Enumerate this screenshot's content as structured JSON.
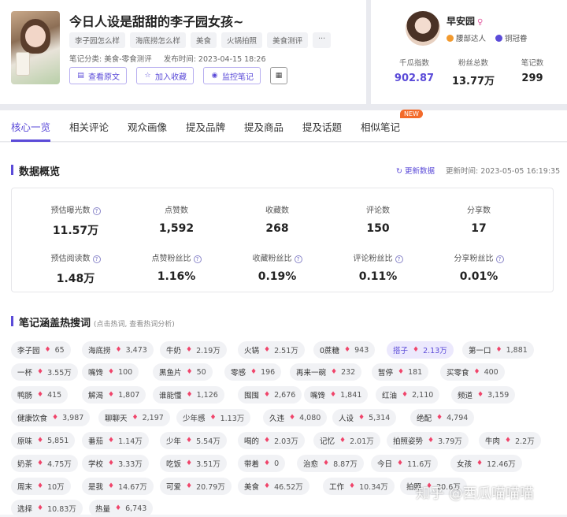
{
  "note": {
    "title": "今日人设是甜甜的李子园女孩~",
    "tags": [
      "李子园怎么样",
      "海底捞怎么样",
      "美食",
      "火锅拍照",
      "美食测评",
      "···"
    ],
    "category": "笔记分类: 美食-零食测评",
    "publish_time": "发布时间: 2023-04-15 18:26",
    "buttons": {
      "view_original": "查看原文",
      "add_favorite": "加入收藏",
      "monitor": "监控笔记"
    }
  },
  "user": {
    "name": "早安园",
    "gender_symbol": "♀",
    "label_1": "腰部达人",
    "label_2": "铜冠眷",
    "stats": [
      {
        "label": "千瓜指数",
        "value": "902.87"
      },
      {
        "label": "粉丝总数",
        "value": "13.77万"
      },
      {
        "label": "笔记数",
        "value": "299"
      }
    ]
  },
  "tabs": [
    "核心一览",
    "相关评论",
    "观众画像",
    "提及品牌",
    "提及商品",
    "提及话题",
    "相似笔记"
  ],
  "new_badge": "NEW",
  "overview": {
    "title": "数据概览",
    "refresh": "更新数据",
    "update_time": "更新时间: 2023-05-05 16:19:35",
    "row1": [
      {
        "label": "预估曝光数",
        "value": "11.57万",
        "q": true
      },
      {
        "label": "点赞数",
        "value": "1,592",
        "q": false
      },
      {
        "label": "收藏数",
        "value": "268",
        "q": false
      },
      {
        "label": "评论数",
        "value": "150",
        "q": false
      },
      {
        "label": "分享数",
        "value": "17",
        "q": false
      }
    ],
    "row2": [
      {
        "label": "预估阅读数",
        "value": "1.48万",
        "q": true
      },
      {
        "label": "点赞粉丝比",
        "value": "1.16%",
        "q": true
      },
      {
        "label": "收藏粉丝比",
        "value": "0.19%",
        "q": true
      },
      {
        "label": "评论粉丝比",
        "value": "0.11%",
        "q": true
      },
      {
        "label": "分享粉丝比",
        "value": "0.01%",
        "q": true
      }
    ]
  },
  "keywords": {
    "title": "笔记涵盖热搜词",
    "subtitle": "(点击热词, 查看热词分析)",
    "rows": [
      [
        [
          "李子园",
          "65"
        ],
        [
          "海底捞",
          "3,473"
        ],
        [
          "牛奶",
          "2.19万"
        ],
        [
          "火锅",
          "2.51万"
        ],
        [
          "0蔗糖",
          "943"
        ],
        [
          "搭子",
          "2.13万"
        ],
        [
          "第一口",
          "1,881"
        ]
      ],
      [
        [
          "一杯",
          "3.55万"
        ],
        [
          "嘴馋",
          "100"
        ],
        [
          "黑鱼片",
          "50"
        ],
        [
          "零感",
          "196"
        ],
        [
          "再来一碗",
          "232"
        ],
        [
          "暂停",
          "181"
        ],
        [
          "买零食",
          "400"
        ]
      ],
      [
        [
          "鸭肠",
          "415"
        ],
        [
          "解渴",
          "1,807"
        ],
        [
          "谁能懂",
          "1,126"
        ],
        [
          "囤囤",
          "2,676"
        ],
        [
          "嘴馋",
          "1,841"
        ],
        [
          "红油",
          "2,110"
        ],
        [
          "频道",
          "3,159"
        ]
      ],
      [
        [
          "健康饮食",
          "3,987"
        ],
        [
          "聊聊天",
          "2,197"
        ],
        [
          "少年感",
          "1.13万"
        ],
        [
          "久违",
          "4,080"
        ],
        [
          "人设",
          "5,314"
        ],
        [
          "绝配",
          "4,794"
        ]
      ],
      [
        [
          "原味",
          "5,851"
        ],
        [
          "番茄",
          "1.14万"
        ],
        [
          "少年",
          "5.54万"
        ],
        [
          "喝的",
          "2.03万"
        ],
        [
          "记忆",
          "2.01万"
        ],
        [
          "拍照姿势",
          "3.79万"
        ],
        [
          "牛肉",
          "2.2万"
        ]
      ],
      [
        [
          "奶茶",
          "4.75万"
        ],
        [
          "学校",
          "3.33万"
        ],
        [
          "吃饭",
          "3.51万"
        ],
        [
          "带着",
          "0"
        ],
        [
          "治愈",
          "8.87万"
        ],
        [
          "今日",
          "11.6万"
        ],
        [
          "女孩",
          "12.46万"
        ]
      ],
      [
        [
          "周末",
          "10万"
        ],
        [
          "是我",
          "14.67万"
        ],
        [
          "可爱",
          "20.79万"
        ],
        [
          "美食",
          "46.52万"
        ],
        [
          "工作",
          "10.34万"
        ],
        [
          "拍照",
          "20.6万"
        ]
      ],
      [
        [
          "选择",
          "10.83万"
        ],
        [
          "热量",
          "6,743"
        ]
      ]
    ]
  },
  "watermark": "知乎 @西瓜喵喵喵"
}
